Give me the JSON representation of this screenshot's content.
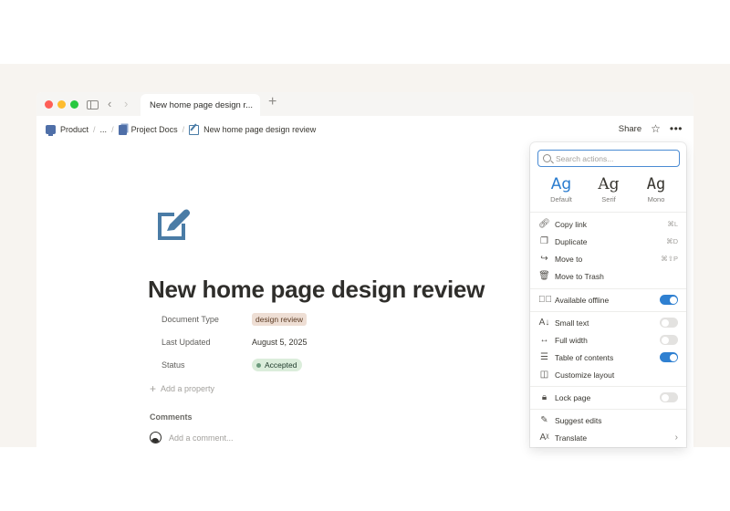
{
  "browser": {
    "tab_title": "New home page design r...",
    "new_tab": "+"
  },
  "breadcrumb": {
    "items": [
      "Product",
      "...",
      "Project Docs",
      "New home page design review"
    ],
    "separator": "/"
  },
  "header": {
    "share_label": "Share",
    "star_icon": "star-icon",
    "more_icon": "more-icon"
  },
  "page": {
    "title": "New home page design review",
    "icon": "edit-icon",
    "properties": [
      {
        "label": "Document Type",
        "value": "design review"
      },
      {
        "label": "Last Updated",
        "value": "August 5, 2025"
      },
      {
        "label": "Status",
        "value": "Accepted"
      }
    ],
    "add_property": "Add a property",
    "comments_heading": "Comments",
    "comment_placeholder": "Add a comment..."
  },
  "menu": {
    "search_placeholder": "Search actions...",
    "fonts": [
      {
        "sample": "Ag",
        "label": "Default",
        "active": true
      },
      {
        "sample": "Ag",
        "label": "Serif",
        "active": false
      },
      {
        "sample": "Ag",
        "label": "Mono",
        "active": false
      }
    ],
    "items": {
      "copy_link": {
        "label": "Copy link",
        "shortcut": "⌘L",
        "icon": "link-icon"
      },
      "duplicate": {
        "label": "Duplicate",
        "shortcut": "⌘D",
        "icon": "duplicate-icon"
      },
      "move_to": {
        "label": "Move to",
        "shortcut": "⌘⇧P",
        "icon": "move-icon"
      },
      "move_to_trash": {
        "label": "Move to Trash",
        "icon": "trash-icon"
      },
      "available_offline": {
        "label": "Available offline",
        "toggle": true,
        "icon": "offline-icon"
      },
      "small_text": {
        "label": "Small text",
        "toggle": false,
        "icon": "small-text-icon"
      },
      "full_width": {
        "label": "Full width",
        "toggle": false,
        "icon": "full-width-icon"
      },
      "table_of_contents": {
        "label": "Table of contents",
        "toggle": true,
        "icon": "toc-icon"
      },
      "customize_layout": {
        "label": "Customize layout",
        "icon": "layout-icon"
      },
      "lock_page": {
        "label": "Lock page",
        "toggle": false,
        "icon": "lock-icon"
      },
      "suggest_edits": {
        "label": "Suggest edits",
        "icon": "suggest-icon"
      },
      "translate": {
        "label": "Translate",
        "icon": "translate-icon"
      }
    }
  },
  "colors": {
    "accent": "#2f80d1",
    "page_icon": "#4a7ca6",
    "tag_bg": "#eeded4",
    "status_bg": "#dbeddb"
  }
}
